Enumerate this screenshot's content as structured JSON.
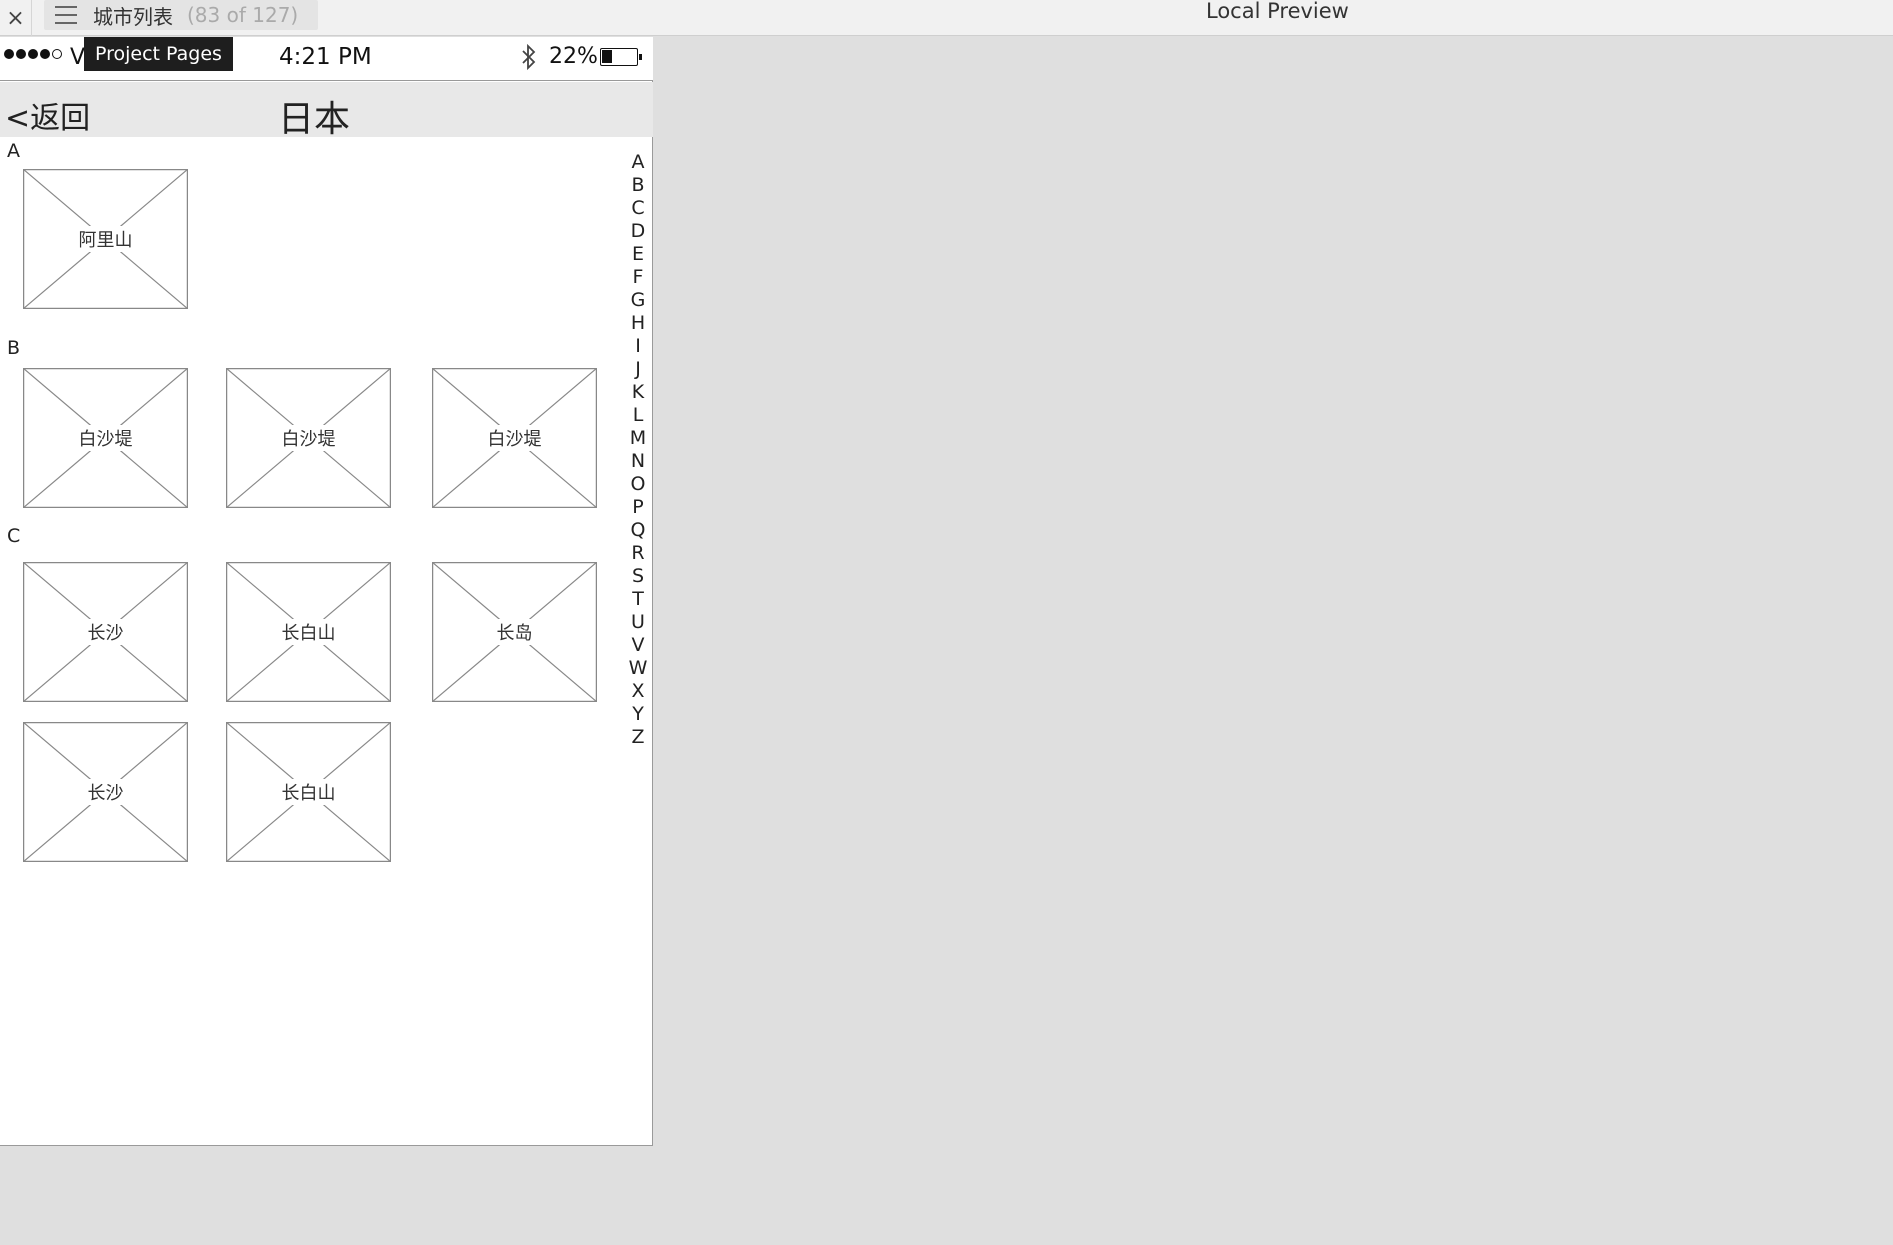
{
  "topbar": {
    "close_glyph": "×",
    "page_name": "城市列表",
    "page_count": "(83 of 127)",
    "preview_title": "Local Preview"
  },
  "tooltip": "Project Pages",
  "statusbar": {
    "carrier": "V",
    "time": "4:21 PM",
    "battery": "22%",
    "battery_level": 0.22
  },
  "navbar": {
    "back": "<返回",
    "title": "日本"
  },
  "sections": [
    {
      "letter": "A",
      "cities": [
        "阿里山"
      ]
    },
    {
      "letter": "B",
      "cities": [
        "白沙堤",
        "白沙堤",
        "白沙堤"
      ]
    },
    {
      "letter": "C",
      "cities": [
        "长沙",
        "长白山",
        "长岛",
        "长沙",
        "长白山"
      ]
    }
  ],
  "index_letters": [
    "A",
    "B",
    "C",
    "D",
    "E",
    "F",
    "G",
    "H",
    "I",
    "J",
    "K",
    "L",
    "M",
    "N",
    "O",
    "P",
    "Q",
    "R",
    "S",
    "T",
    "U",
    "V",
    "W",
    "X",
    "Y",
    "Z"
  ]
}
